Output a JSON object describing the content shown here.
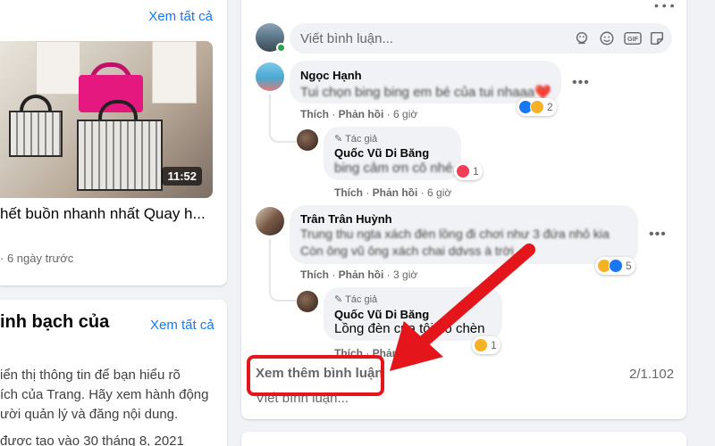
{
  "left_panel": {
    "video_card": {
      "see_all": "Xem tất cả",
      "duration": "11:52",
      "title": "hết buồn nhanh nhất Quay h...",
      "meta": "· 6 ngày trước"
    },
    "transparency_card": {
      "title": "inh bạch của",
      "see_all": "Xem tất cả",
      "lines": [
        "iển thị thông tin để bạn hiểu rõ",
        "ích của Trang. Hãy xem hành động",
        "ười quản lý và đăng nội dung."
      ],
      "date": "được tạo vào 30 tháng 8, 2021"
    }
  },
  "feed": {
    "comment_input": {
      "placeholder": "Viết bình luận..."
    },
    "comments": [
      {
        "name": "Ngọc Hạnh",
        "text": "Tui chọn bing bing em bé của tui nhaaa❤️",
        "like": "Thích",
        "reply": "Phản hồi",
        "time": "6 giờ",
        "reactions": "2",
        "replies": [
          {
            "badge": "Tác giả",
            "name": "Quốc Vũ Di Băng",
            "text": "bing cảm ơn cô nhé",
            "like": "Thích",
            "reply": "Phản hồi",
            "time": "6 giờ",
            "reactions": "1"
          }
        ]
      },
      {
        "name": "Trân Trân Huỳnh",
        "text_lines": [
          "Trung thu ngta xách đèn lồng đi chơi như 3 đứa nhỏ kia",
          "Còn ông vũ ông xách chai ddvss à trời"
        ],
        "like": "Thích",
        "reply": "Phản hồi",
        "time": "3 giờ",
        "reactions": "5",
        "replies": [
          {
            "badge": "Tác giả",
            "name": "Quốc Vũ Di Băng",
            "text": "Lồng đèn của tôi đó chèn",
            "like": "Thích",
            "reply": "Phản hồi",
            "time": "",
            "reactions": "1"
          }
        ]
      }
    ],
    "see_more": "Xem thêm bình luận",
    "count": "2/1.102",
    "write_comment": "Viết bình luận..."
  },
  "colors": {
    "accent": "#1877f2",
    "highlight": "#e5161b",
    "online": "#31a24c"
  }
}
